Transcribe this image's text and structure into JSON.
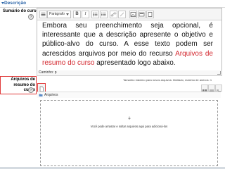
{
  "section": {
    "title": "Descrição"
  },
  "fields": {
    "summary_label": "Sumário do curso",
    "files_label_line1": "Arquivos de",
    "files_label_line2": "resumo do curso"
  },
  "editor": {
    "paragraph_select": "Parágrafo",
    "bold": "B",
    "italic": "I",
    "path_label": "Caminho: p"
  },
  "callout": {
    "text_before": "Embora seu preenchimento seja opcional, é interessante que a descrição apresente o objetivo e público-alvo do curso. A esse texto podem ser acrescidos arquivos por meio do recurso ",
    "link_text": "Arquivos de resumo do curso",
    "text_after": " apresentado logo abaixo."
  },
  "filemanager": {
    "limits_note": "Tamanho máximo para novos arquivos: Ilimitado, máximo de anexos: 1",
    "folder_label": "Arquivos",
    "drop_text": "Você pode arrastar e soltar arquivos aqui para adicioná-los"
  },
  "colors": {
    "accent": "#2a64a8",
    "highlight": "#e03a3a",
    "link": "#d3272e"
  },
  "icons": [
    "help-icon",
    "image-icon",
    "media-icon",
    "file-picker-icon",
    "folder-icon",
    "drop-arrow-icon"
  ]
}
